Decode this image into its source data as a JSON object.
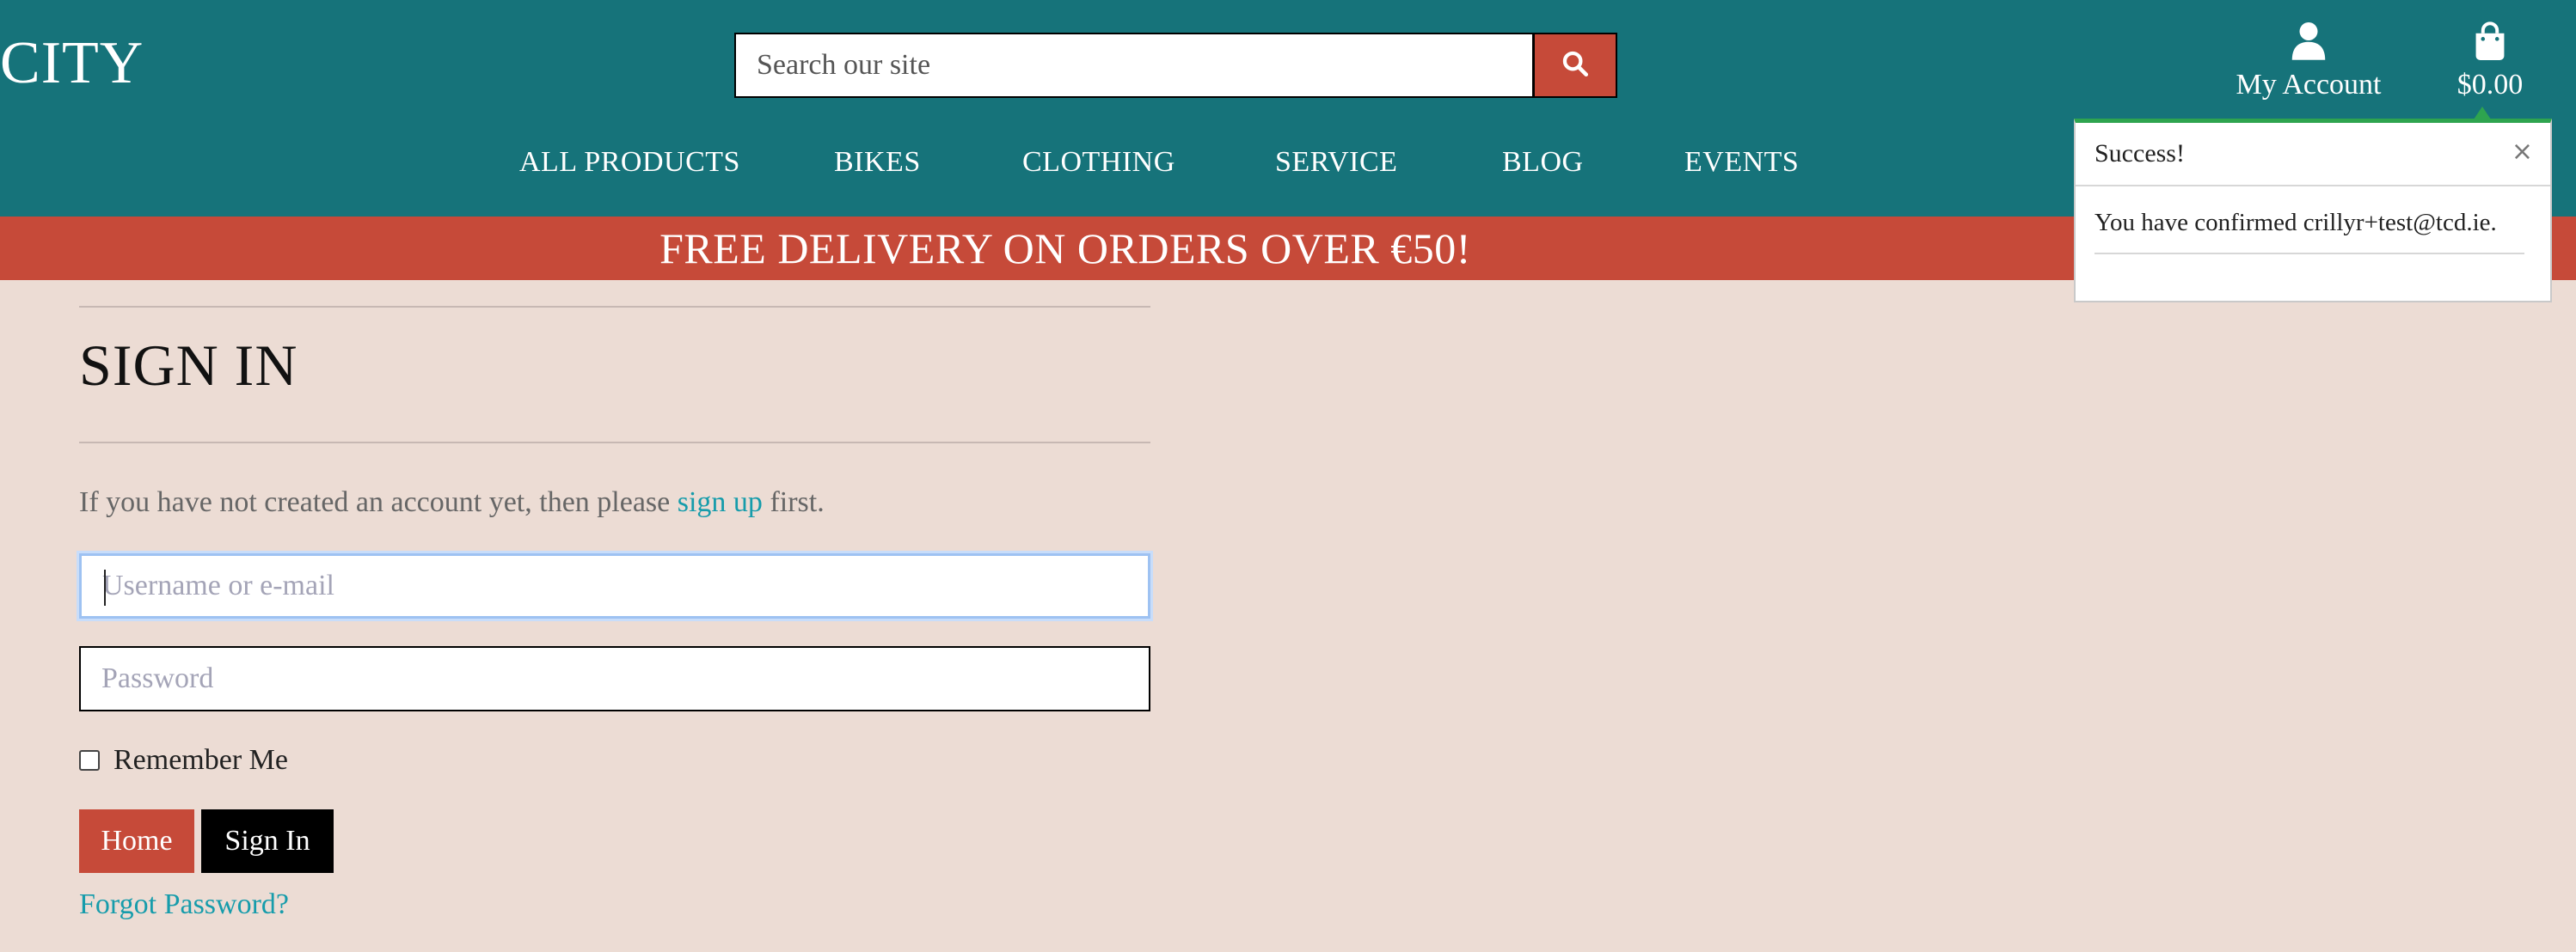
{
  "brand": {
    "visible_logo_text": "CITY"
  },
  "search": {
    "placeholder": "Search our site",
    "icon": "search-icon"
  },
  "account": {
    "label": "My Account",
    "icon": "user-icon"
  },
  "bag": {
    "total": "$0.00",
    "icon": "shopping-bag-icon"
  },
  "nav": {
    "items": [
      {
        "label": "ALL PRODUCTS"
      },
      {
        "label": "BIKES"
      },
      {
        "label": "CLOTHING"
      },
      {
        "label": "SERVICE"
      },
      {
        "label": "BLOG"
      },
      {
        "label": "EVENTS"
      }
    ]
  },
  "promo": {
    "text": "FREE DELIVERY ON ORDERS OVER €50!"
  },
  "toast": {
    "title": "Success!",
    "message": "You have confirmed crillyr+test@tcd.ie.",
    "close": "×",
    "accent": "#2ea44f"
  },
  "page": {
    "title": "SIGN IN",
    "intro_before": "If you have not created an account yet, then please ",
    "intro_link": "sign up",
    "intro_after": " first.",
    "username_placeholder": "Username or e-mail",
    "password_placeholder": "Password",
    "remember_label": "Remember Me",
    "home_button": "Home",
    "signin_button": "Sign In",
    "forgot_link": "Forgot Password?"
  },
  "colors": {
    "header_bg": "#16737a",
    "promo_bg": "#c64a39",
    "page_bg": "#ecdcd4",
    "link": "#169cab",
    "button_primary": "#c64a39",
    "button_dark": "#000000"
  }
}
